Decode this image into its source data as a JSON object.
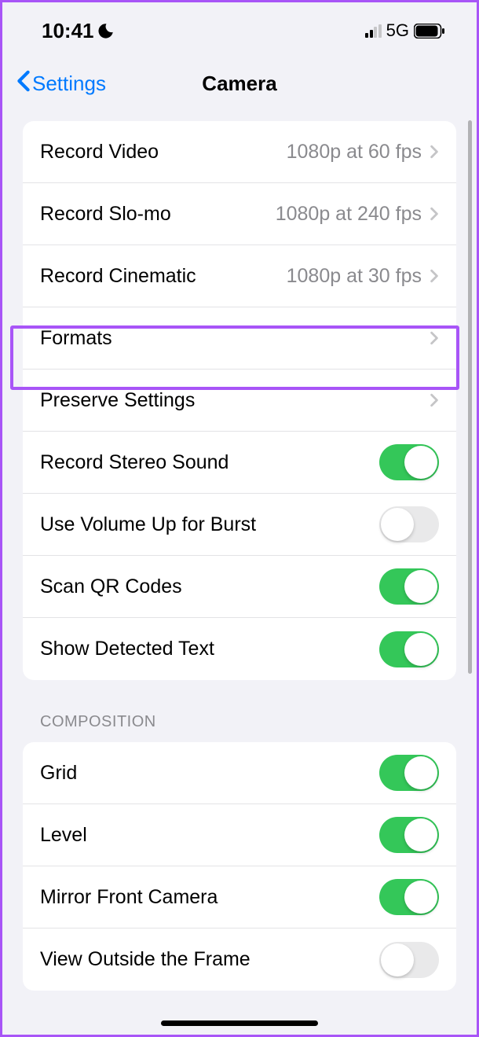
{
  "status": {
    "time": "10:41",
    "network": "5G"
  },
  "nav": {
    "back": "Settings",
    "title": "Camera"
  },
  "settings": [
    {
      "label": "Record Video",
      "value": "1080p at 60 fps",
      "type": "nav"
    },
    {
      "label": "Record Slo-mo",
      "value": "1080p at 240 fps",
      "type": "nav"
    },
    {
      "label": "Record Cinematic",
      "value": "1080p at 30 fps",
      "type": "nav"
    },
    {
      "label": "Formats",
      "type": "nav"
    },
    {
      "label": "Preserve Settings",
      "type": "nav"
    },
    {
      "label": "Record Stereo Sound",
      "type": "toggle",
      "on": true
    },
    {
      "label": "Use Volume Up for Burst",
      "type": "toggle",
      "on": false
    },
    {
      "label": "Scan QR Codes",
      "type": "toggle",
      "on": true
    },
    {
      "label": "Show Detected Text",
      "type": "toggle",
      "on": true
    }
  ],
  "composition_header": "COMPOSITION",
  "composition": [
    {
      "label": "Grid",
      "type": "toggle",
      "on": true
    },
    {
      "label": "Level",
      "type": "toggle",
      "on": true
    },
    {
      "label": "Mirror Front Camera",
      "type": "toggle",
      "on": true
    },
    {
      "label": "View Outside the Frame",
      "type": "toggle",
      "on": false
    }
  ]
}
